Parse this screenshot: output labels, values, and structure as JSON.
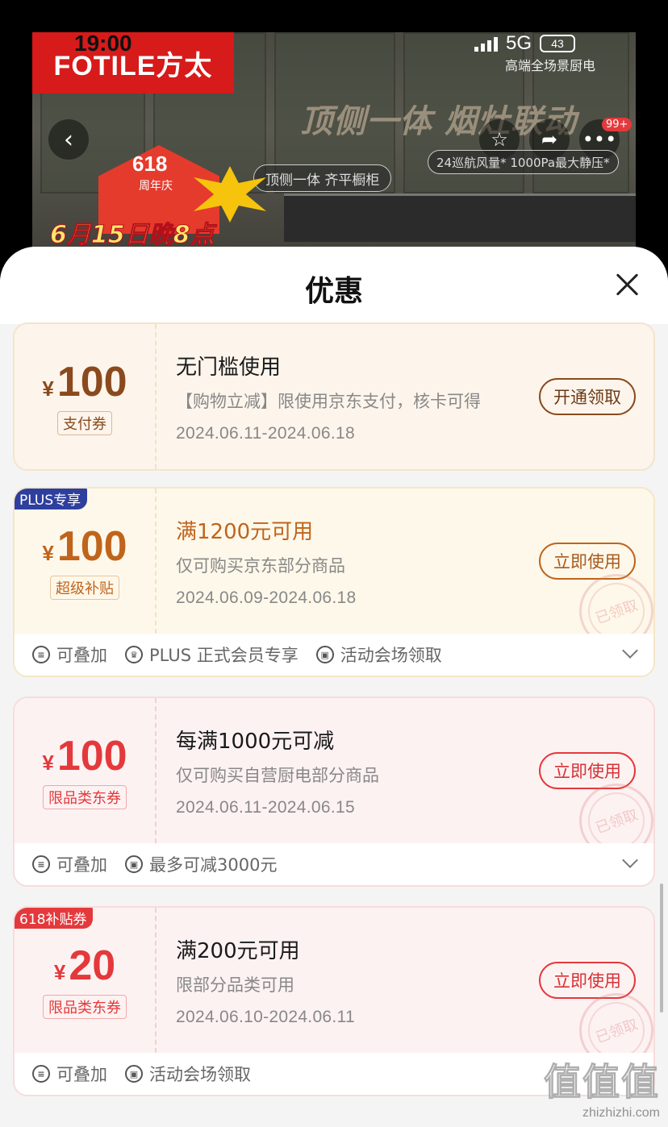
{
  "status_bar": {
    "time": "19:00",
    "network": "5G",
    "battery": "43"
  },
  "hero": {
    "brand": "FOTILE方太",
    "tagline": "高端全场景厨电",
    "slogan": "顶侧一体 烟灶联动",
    "feature_1": "24巡航风量* 1000Pa最大静压*",
    "feature_2": "顶侧一体 齐平橱柜",
    "promo_618": "618",
    "promo_sub": "周年庆",
    "promo_date": "6月15日晚8点",
    "cart_badge": "99+",
    "icons": {
      "back": "chevron-left-icon",
      "favorite": "star-icon",
      "share": "share-icon",
      "more": "more-icon"
    }
  },
  "sheet": {
    "title": "优惠",
    "coupons": [
      {
        "currency": "¥",
        "amount": "100",
        "type": "支付券",
        "condition": "无门槛使用",
        "description": "【购物立减】限使用京东支付，核卡可得",
        "date": "2024.06.11-2024.06.18",
        "button": "开通领取"
      },
      {
        "corner": "PLUS专享",
        "currency": "¥",
        "amount": "100",
        "type": "超级补贴",
        "condition": "满1200元可用",
        "description": "仅可购买京东部分商品",
        "date": "2024.06.09-2024.06.18",
        "button": "立即使用",
        "stamp": "已领取",
        "footer": [
          "可叠加",
          "PLUS 正式会员专享",
          "活动会场领取"
        ]
      },
      {
        "currency": "¥",
        "amount": "100",
        "type": "限品类东券",
        "condition": "每满1000元可减",
        "description": "仅可购买自营厨电部分商品",
        "date": "2024.06.11-2024.06.15",
        "button": "立即使用",
        "stamp": "已领取",
        "footer": [
          "可叠加",
          "最多可减3000元"
        ]
      },
      {
        "corner": "618补贴券",
        "currency": "¥",
        "amount": "20",
        "type": "限品类东券",
        "condition": "满200元可用",
        "description": "限部分品类可用",
        "date": "2024.06.10-2024.06.11",
        "button": "立即使用",
        "stamp": "已领取",
        "footer": [
          "可叠加",
          "活动会场领取"
        ]
      }
    ]
  },
  "watermark": {
    "logo": "值值值",
    "url": "zhizhizhi.com"
  },
  "colors": {
    "brand_red": "#d71a1a",
    "coupon_brown": "#8a4a1e",
    "coupon_orange": "#c0641c",
    "coupon_red": "#e4393c",
    "plus_blue": "#2f3f9e"
  }
}
